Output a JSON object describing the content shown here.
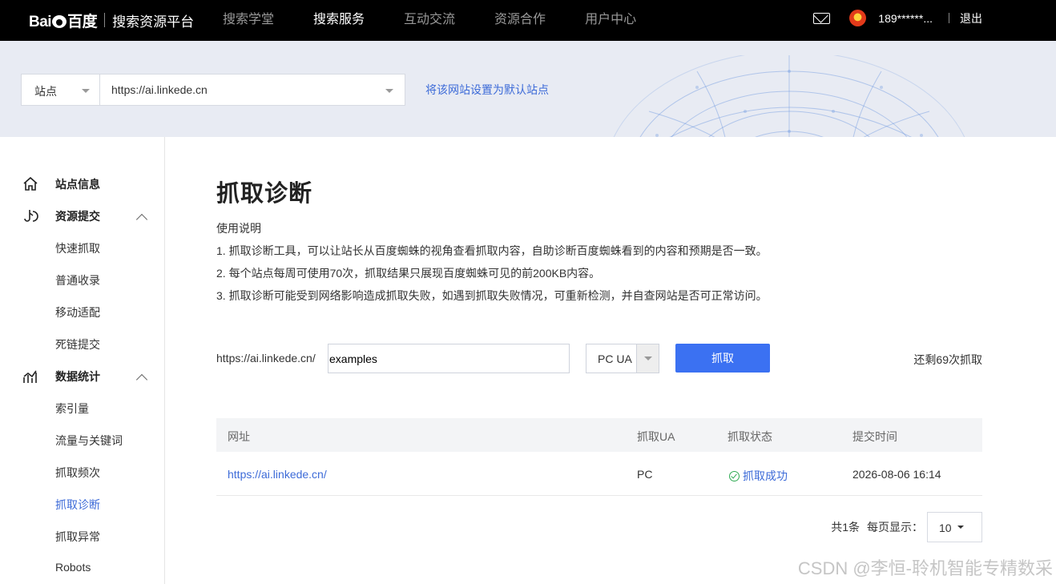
{
  "header": {
    "logo_text": "Baidu百度",
    "platform_name": "搜索资源平台",
    "nav": [
      "搜索学堂",
      "搜索服务",
      "互动交流",
      "资源合作",
      "用户中心"
    ],
    "active_nav": "搜索服务",
    "user_name": "189******...",
    "logout_label": "退出"
  },
  "banner": {
    "site_select_label": "站点",
    "site_url": "https://ai.linkede.cn",
    "set_default_link": "将该网站设置为默认站点"
  },
  "sidebar": {
    "groups": [
      {
        "label": "站点信息",
        "icon": "home-icon"
      },
      {
        "label": "资源提交",
        "icon": "submit-icon",
        "items": [
          "快速抓取",
          "普通收录",
          "移动适配",
          "死链提交"
        ]
      },
      {
        "label": "数据统计",
        "icon": "stats-icon",
        "items": [
          "索引量",
          "流量与关键词",
          "抓取频次",
          "抓取诊断",
          "抓取异常",
          "Robots"
        ]
      }
    ],
    "active_item": "抓取诊断"
  },
  "main": {
    "title": "抓取诊断",
    "instructions": [
      "使用说明",
      "1. 抓取诊断工具，可以让站长从百度蜘蛛的视角查看抓取内容，自助诊断百度蜘蛛看到的内容和预期是否一致。",
      "2. 每个站点每周可使用70次，抓取结果只展现百度蜘蛛可见的前200KB内容。",
      "3. 抓取诊断可能受到网络影响造成抓取失败，如遇到抓取失败情况，可重新检测，并自查网站是否可正常访问。"
    ],
    "url_prefix": "https://ai.linkede.cn/",
    "path_value": "examples",
    "ua_selected": "PC UA",
    "fetch_button": "抓取",
    "remaining": "还剩69次抓取",
    "table": {
      "columns": [
        "网址",
        "抓取UA",
        "抓取状态",
        "提交时间"
      ],
      "rows": [
        {
          "url": "https://ai.linkede.cn/",
          "ua": "PC",
          "status": "抓取成功",
          "time": "2026-08-06 16:14"
        }
      ]
    },
    "pagination": {
      "total": "共1条",
      "per_page_label": "每页显示：",
      "per_page_value": "10"
    }
  },
  "watermark": "CSDN @李恒-聆机智能专精数采"
}
